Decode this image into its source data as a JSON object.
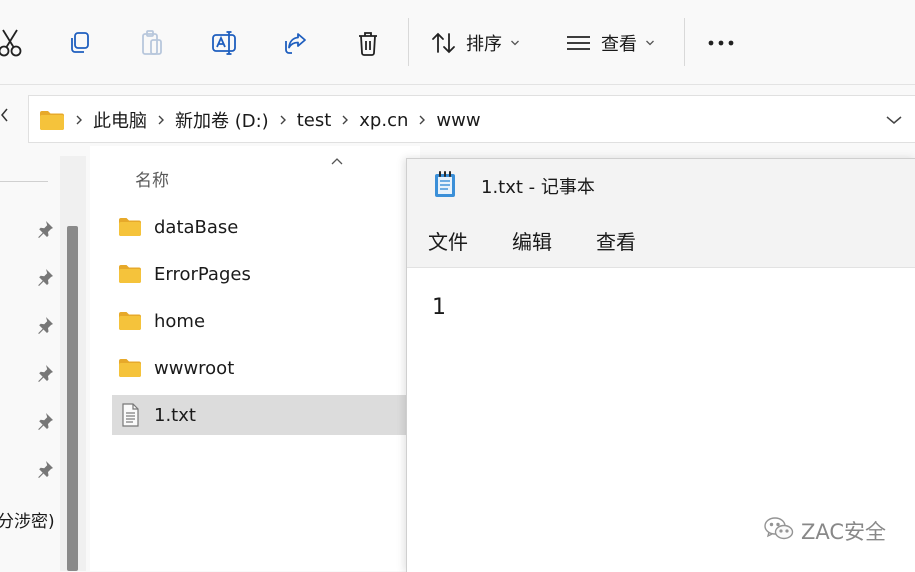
{
  "toolbar": {
    "sort_label": "排序",
    "view_label": "查看"
  },
  "address": {
    "crumbs": [
      "此电脑",
      "新加卷 (D:)",
      "test",
      "xp.cn",
      "www"
    ]
  },
  "nav": {
    "partial_item_text": "分涉密)"
  },
  "filelist": {
    "column_name": "名称",
    "items": [
      {
        "name": "dataBase",
        "type": "folder-icon"
      },
      {
        "name": "ErrorPages",
        "type": "folder-icon"
      },
      {
        "name": "home",
        "type": "folder-icon"
      },
      {
        "name": "wwwroot",
        "type": "folder-icon"
      },
      {
        "name": "1.txt",
        "type": "text-file-icon",
        "selected": true
      }
    ]
  },
  "notepad": {
    "title": "1.txt - 记事本",
    "menu": [
      "文件",
      "编辑",
      "查看"
    ],
    "content": "1"
  },
  "watermark": {
    "text": "ZAC安全"
  },
  "colors": {
    "folder": "#f5c33b",
    "folder_tab": "#e7a92a",
    "selection": "#dcdcdc",
    "notepad_icon": "#3a8fd8",
    "scroll_thumb": "#8a8a8a"
  }
}
